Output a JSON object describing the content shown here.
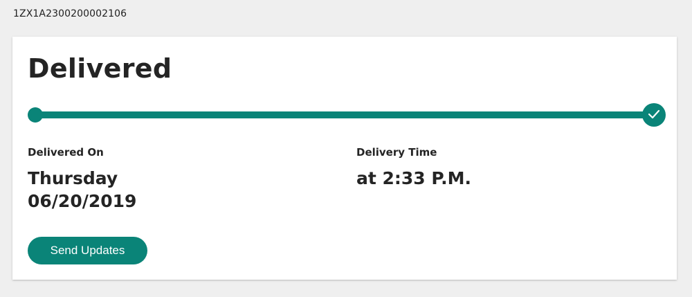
{
  "tracking_number": "1ZX1A2300200002106",
  "status": {
    "title": "Delivered",
    "progress": 1.0
  },
  "delivered_on": {
    "label": "Delivered On",
    "day": "Thursday",
    "date": "06/20/2019"
  },
  "delivery_time": {
    "label": "Delivery Time",
    "value": "at 2:33 P.M."
  },
  "actions": {
    "send_updates_label": "Send Updates"
  },
  "colors": {
    "accent": "#0a8478",
    "page_background": "#efefef",
    "card_background": "#ffffff",
    "text": "#242424"
  },
  "icons": {
    "progress_end": "check-icon"
  }
}
